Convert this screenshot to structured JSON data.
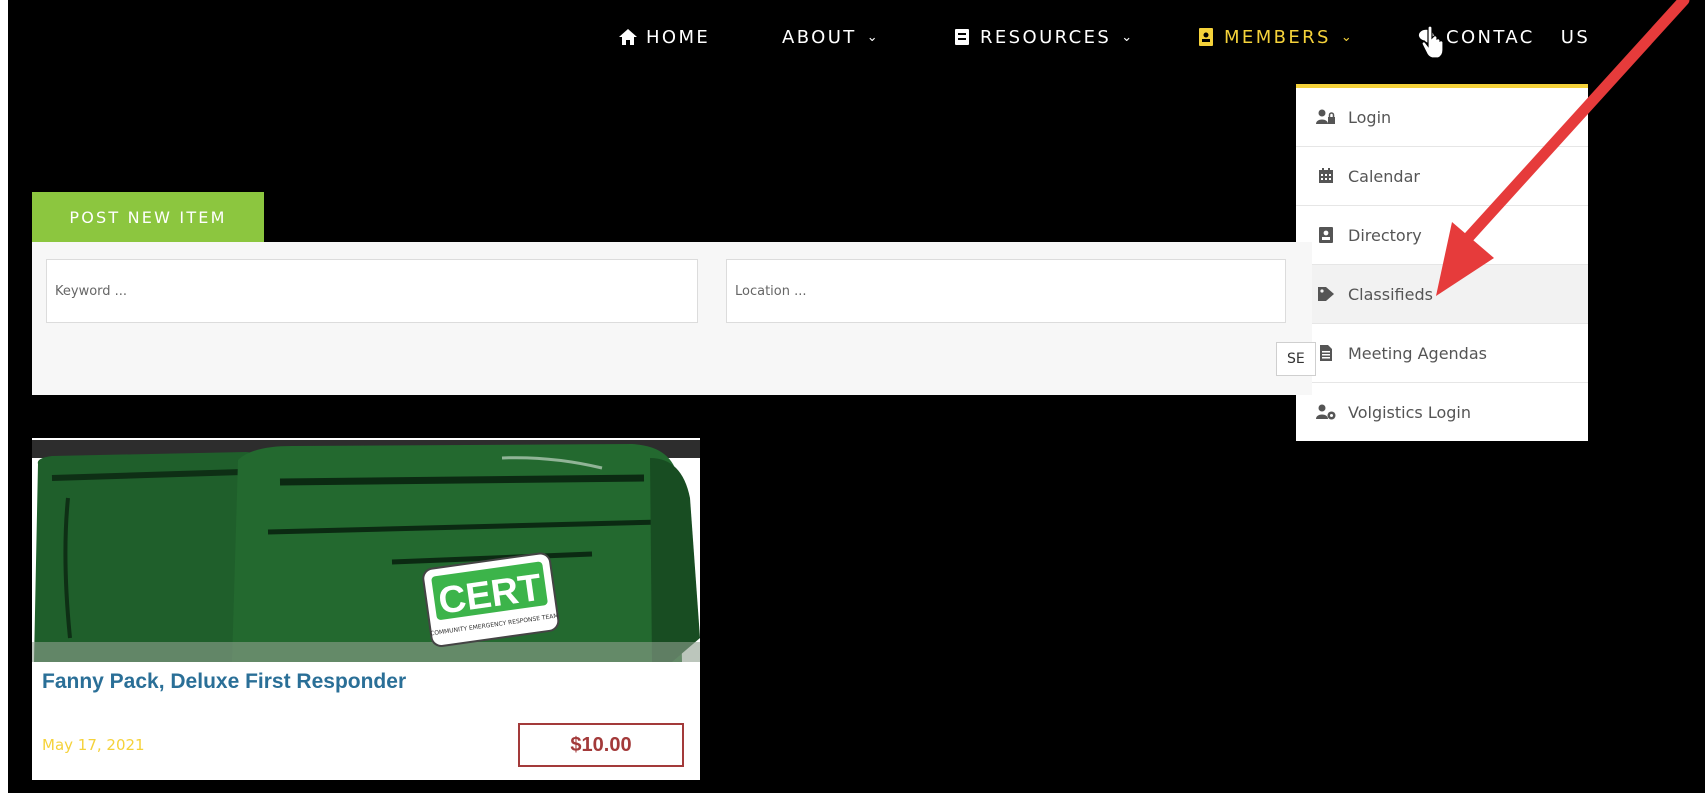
{
  "nav": {
    "items": [
      {
        "label": "HOME",
        "icon": "home-icon"
      },
      {
        "label": "ABOUT",
        "icon": null
      },
      {
        "label": "RESOURCES",
        "icon": "book-icon"
      },
      {
        "label": "MEMBERS",
        "icon": "id-badge-icon"
      },
      {
        "label": "CONTAC",
        "icon": "chat-icon"
      },
      {
        "label": "US",
        "icon": null
      }
    ],
    "active_color": "#f5d23a"
  },
  "members_menu": {
    "items": [
      {
        "label": "Login",
        "icon": "user-lock-icon"
      },
      {
        "label": "Calendar",
        "icon": "calendar-icon"
      },
      {
        "label": "Directory",
        "icon": "address-book-icon"
      },
      {
        "label": "Classifieds",
        "icon": "tag-icon"
      },
      {
        "label": "Meeting Agendas",
        "icon": "document-icon"
      },
      {
        "label": "Volgistics Login",
        "icon": "user-gear-icon"
      }
    ]
  },
  "classifieds": {
    "post_new_label": "POST NEW ITEM",
    "keyword_placeholder": "Keyword ...",
    "location_placeholder": "Location ...",
    "search_label": "SE"
  },
  "listing": {
    "title": "Fanny Pack, Deluxe First Responder",
    "date": "May 17, 2021",
    "price": "$10.00",
    "image_logo_text": "CERT",
    "image_logo_subtext": "COMMUNITY EMERGENCY RESPONSE TEAM"
  },
  "colors": {
    "accent_green": "#8cc63f",
    "accent_yellow": "#f5d23a",
    "title_blue": "#2a6f97",
    "price_red": "#a33a3a",
    "annotation_arrow": "#e63b3b"
  }
}
